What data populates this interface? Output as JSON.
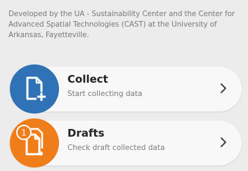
{
  "credits": "Developed by the UA - Sustainability Center and the Center for Advanced Spatial Technologies (CAST) at the University of Arkansas, Fayetteville.",
  "menu": [
    {
      "title": "Collect",
      "subtitle": "Start collecting data",
      "icon": "new-document-icon",
      "color": "#2f72b6"
    },
    {
      "title": "Drafts",
      "subtitle": "Check draft collected data",
      "icon": "drafts-document-icon",
      "badge": "1",
      "color": "#ef7d1a"
    }
  ],
  "chevron_icon": "chevron-right-icon"
}
